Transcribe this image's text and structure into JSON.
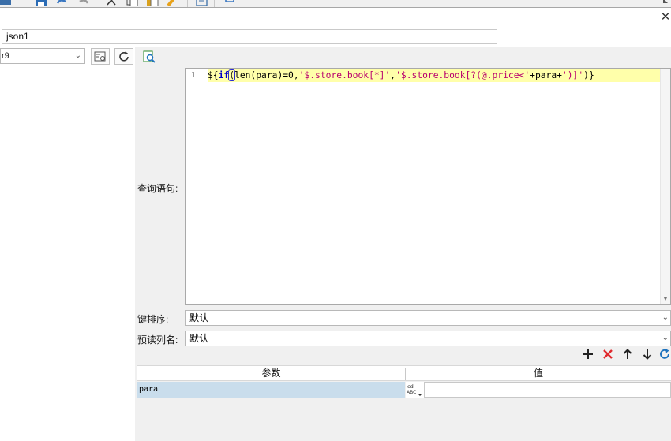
{
  "header": {
    "name_value": "json1",
    "close_symbol": "✕"
  },
  "left": {
    "datasource_value": "r9",
    "datasource_arrow": "⌄"
  },
  "form": {
    "query_label": "查询语句:",
    "sort_label": "键排序:",
    "sort_value": "默认",
    "preview_label": "预读列名:",
    "preview_value": "默认"
  },
  "editor": {
    "line_number": "1",
    "code": {
      "p1": "${",
      "p2": "if",
      "p3": "(",
      "p4": "len(para)=0,",
      "p5": "'$.store.book[*]'",
      "p6": ",",
      "p7": "'$.store.book[?(@.price<'",
      "p8": "+para+",
      "p9": "')]'",
      "p10": ")}"
    }
  },
  "param_table": {
    "columns": [
      "参数",
      "值"
    ],
    "rows": [
      {
        "param": "para",
        "value": ""
      }
    ]
  },
  "icons": {
    "add": "plus-icon",
    "delete": "delete-x-icon",
    "up": "arrow-up-icon",
    "down": "arrow-down-icon",
    "refresh": "refresh-icon",
    "type": "abc-type-icon"
  },
  "colors": {
    "accent_blue": "#1e73be",
    "delete_red": "#e0282c",
    "highlight_line": "#ffffaa",
    "selected_row": "#c9ddec"
  }
}
